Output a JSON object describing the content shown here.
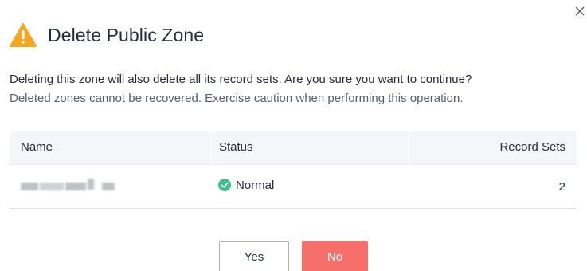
{
  "dialog": {
    "title": "Delete Public Zone",
    "message_line1": "Deleting this zone will also delete all its record sets. Are you sure you want to continue?",
    "message_line2": "Deleted zones cannot be recovered. Exercise caution when performing this operation.",
    "close_icon": "close-icon",
    "warning_icon": "warning-icon",
    "warning_color": "#f5a623"
  },
  "table": {
    "columns": [
      "Name",
      "Status",
      "Record Sets"
    ],
    "rows": [
      {
        "name": "",
        "status": "Normal",
        "status_icon": "check-circle-icon",
        "status_color": "#3fbf8a",
        "record_sets": "2"
      }
    ]
  },
  "actions": {
    "yes_label": "Yes",
    "no_label": "No",
    "no_color": "#f66f6a"
  }
}
